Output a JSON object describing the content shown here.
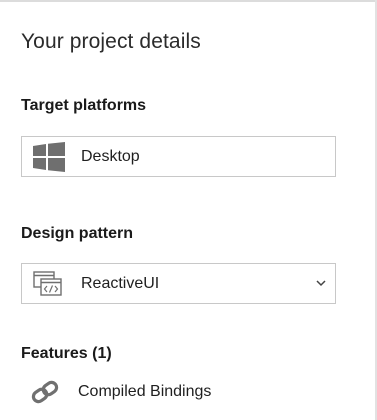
{
  "panel": {
    "title": "Your project details"
  },
  "target_platforms": {
    "label": "Target platforms",
    "selected": {
      "text": "Desktop",
      "icon": "windows-logo-icon"
    }
  },
  "design_pattern": {
    "label": "Design pattern",
    "selected": {
      "text": "ReactiveUI",
      "icon": "code-window-icon"
    },
    "dropdown_icon": "chevron-down-icon"
  },
  "features": {
    "label": "Features (1)",
    "items": [
      {
        "text": "Compiled Bindings",
        "icon": "link-icon"
      }
    ]
  },
  "colors": {
    "border": "#c8c8c8",
    "icon_gray": "#6f6f6f",
    "text": "#1f1f1f"
  }
}
